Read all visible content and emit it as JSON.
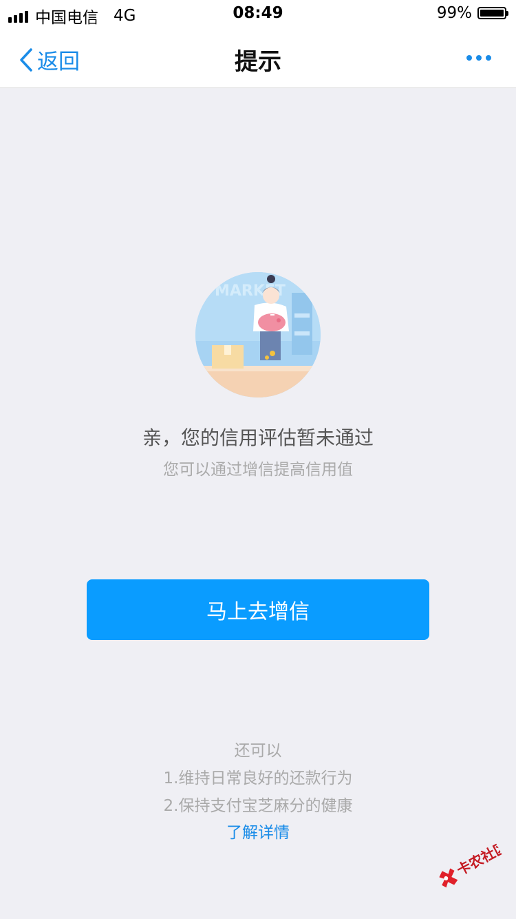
{
  "status_bar": {
    "carrier": "中国电信",
    "network": "4G",
    "time": "08:49",
    "battery_percent": "99%",
    "battery_level": 0.99
  },
  "nav": {
    "back_label": "返回",
    "title": "提示"
  },
  "illustration": {
    "sign_text": "MARKET",
    "icon": "shopkeeper-piggy-bank-illustration"
  },
  "message": {
    "headline": "亲，您的信用评估暂未通过",
    "subline": "您可以通过增信提高信用值"
  },
  "cta": {
    "label": "马上去增信",
    "color": "#0a9cff"
  },
  "alternatives": {
    "title": "还可以",
    "tips": [
      "1.维持日常良好的还款行为",
      "2.保持支付宝芝麻分的健康"
    ],
    "learn_more": "了解详情"
  },
  "watermark": {
    "text": "卡农社区"
  },
  "colors": {
    "accent": "#1a8ce8",
    "background": "#efeff4"
  }
}
